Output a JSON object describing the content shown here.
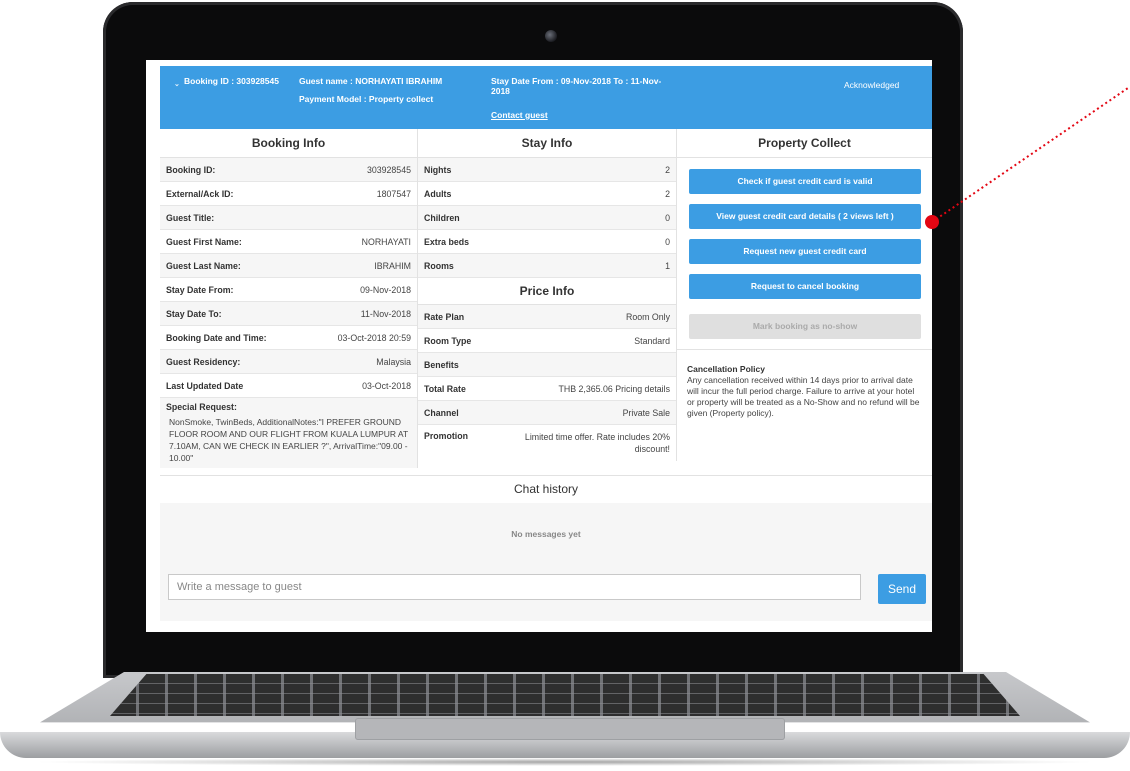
{
  "header": {
    "booking_id": "Booking ID : 303928545",
    "guest_name": "Guest name : NORHAYATI IBRAHIM",
    "payment_model": "Payment Model : Property collect",
    "stay_dates_line1": "Stay Date From : 09-Nov-2018 To : 11-Nov-",
    "stay_dates_line2": "2018",
    "contact_guest": "Contact guest",
    "status": "Acknowledged",
    "accent_color": "#3c9de3"
  },
  "booking_info": {
    "title": "Booking Info",
    "rows": [
      {
        "label": "Booking ID:",
        "value": "303928545"
      },
      {
        "label": "External/Ack ID:",
        "value": "1807547"
      },
      {
        "label": "Guest Title:",
        "value": ""
      },
      {
        "label": "Guest First Name:",
        "value": "NORHAYATI"
      },
      {
        "label": "Guest Last Name:",
        "value": "IBRAHIM"
      },
      {
        "label": "Stay Date From:",
        "value": "09-Nov-2018"
      },
      {
        "label": "Stay Date To:",
        "value": "11-Nov-2018"
      },
      {
        "label": "Booking Date and Time:",
        "value": "03-Oct-2018 20:59"
      },
      {
        "label": "Guest Residency:",
        "value": "Malaysia"
      },
      {
        "label": "Last Updated Date",
        "value": "03-Oct-2018"
      }
    ],
    "special_request_label": "Special Request:",
    "special_request_value": "NonSmoke, TwinBeds, AdditionalNotes:\"I PREFER GROUND FLOOR ROOM AND OUR FLIGHT FROM KUALA LUMPUR AT 7.10AM, CAN WE CHECK IN EARLIER ?\", ArrivalTime:\"09.00 - 10.00\""
  },
  "stay_info": {
    "title": "Stay Info",
    "rows": [
      {
        "label": "Nights",
        "value": "2"
      },
      {
        "label": "Adults",
        "value": "2"
      },
      {
        "label": "Children",
        "value": "0"
      },
      {
        "label": "Extra beds",
        "value": "0"
      },
      {
        "label": "Rooms",
        "value": "1"
      }
    ]
  },
  "price_info": {
    "title": "Price Info",
    "rows": [
      {
        "label": "Rate Plan",
        "value": "Room Only"
      },
      {
        "label": "Room Type",
        "value": "Standard"
      },
      {
        "label": "Benefits",
        "value": ""
      },
      {
        "label": "Total Rate",
        "value": "THB 2,365.06  Pricing details"
      },
      {
        "label": "Channel",
        "value": "Private Sale"
      }
    ],
    "promotion_label": "Promotion",
    "promotion_value": "Limited time offer. Rate includes 20% discount!"
  },
  "property_collect": {
    "title": "Property Collect",
    "buttons": [
      {
        "label": "Check if guest credit card is valid"
      },
      {
        "label": "View guest credit card details ( 2 views left )"
      },
      {
        "label": "Request new guest credit card"
      },
      {
        "label": "Request to cancel booking"
      },
      {
        "label": "Mark booking as no-show"
      }
    ],
    "policy_title": "Cancellation Policy",
    "policy_text": "Any cancellation received within 14 days prior to arrival date will incur the full period charge. Failure to arrive at your hotel or property will be treated as a No-Show and no refund will be given (Property policy)."
  },
  "chat": {
    "title": "Chat history",
    "empty": "No messages yet",
    "placeholder": "Write a message to guest",
    "send_label": "Send"
  },
  "icons": {
    "collapse": "chevron-down-icon",
    "camera": "camera-icon",
    "pointer": "red-pointer-dot"
  }
}
